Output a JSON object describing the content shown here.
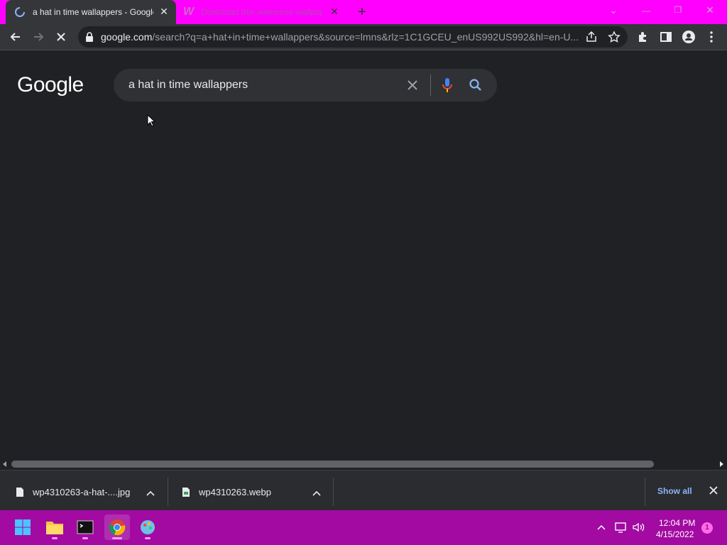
{
  "tabs": [
    {
      "title": "a hat in time wallappers - Google",
      "close": "✕"
    },
    {
      "title": "Download this awesome wallpaper",
      "close": "✕"
    }
  ],
  "new_tab": "+",
  "window_controls": {
    "minimize": "—",
    "restore": "❐",
    "close": "✕",
    "dropdown": "⌄"
  },
  "address_bar": {
    "domain": "google.com",
    "path": "/search?q=a+hat+in+time+wallappers&source=lmns&rlz=1C1GCEU_enUS992US992&hl=en-U..."
  },
  "google": {
    "logo_text": "Google",
    "query": "a hat in time wallappers",
    "logo_colors": [
      "#ffffff"
    ]
  },
  "downloads": [
    {
      "name": "wp4310263-a-hat-....jpg"
    },
    {
      "name": "wp4310263.webp"
    }
  ],
  "downloads_show_all": "Show all",
  "taskbar": {
    "time": "12:04 PM",
    "date": "4/15/2022",
    "notifications": "1"
  },
  "colors": {
    "titlebar": "#ff00ff",
    "taskbar": "#a20aa2",
    "page_bg": "#202124"
  }
}
